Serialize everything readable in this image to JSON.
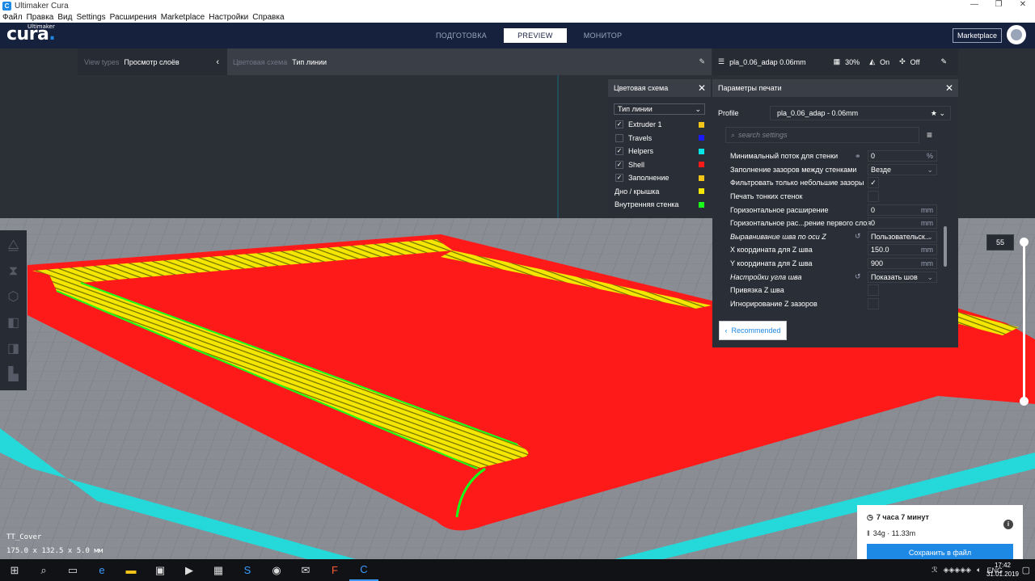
{
  "window": {
    "title": "Ultimaker Cura",
    "app_icon": "C",
    "controls": [
      "—",
      "❐",
      "✕"
    ]
  },
  "menu": [
    "Файл",
    "Правка",
    "Вид",
    "Settings",
    "Расширения",
    "Marketplace",
    "Настройки",
    "Справка"
  ],
  "header": {
    "logo": "cura",
    "logo_brand": "Ultimaker",
    "stages": [
      "ПОДГОТОВКА",
      "PREVIEW",
      "МОНИТОР"
    ],
    "active_stage": "PREVIEW",
    "marketplace_button": "Marketplace"
  },
  "view_bar": {
    "label": "View types",
    "value": "Просмотр слоёв"
  },
  "color_bar": {
    "label": "Цветовая схема",
    "value": "Тип линии"
  },
  "print_bar": {
    "profile": "pla_0.06_adap 0.06mm",
    "infill": "30%",
    "support": "On",
    "adhesion": "Off"
  },
  "legend": {
    "title": "Цветовая схема",
    "scheme": "Тип линии",
    "items": [
      {
        "label": "Extruder 1",
        "checkbox": true,
        "checked": true,
        "color": "#f5c518"
      },
      {
        "label": "Travels",
        "checkbox": true,
        "checked": false,
        "color": "#1a1aff"
      },
      {
        "label": "Helpers",
        "checkbox": true,
        "checked": true,
        "color": "#00e5e5"
      },
      {
        "label": "Shell",
        "checkbox": true,
        "checked": true,
        "color": "#ff1a1a"
      },
      {
        "label": "Заполнение",
        "checkbox": true,
        "checked": true,
        "color": "#f5c518"
      },
      {
        "label": "Дно / крышка",
        "checkbox": false,
        "checked": false,
        "color": "#f5e600"
      },
      {
        "label": "Внутренняя стенка",
        "checkbox": false,
        "checked": false,
        "color": "#1aff1a"
      }
    ]
  },
  "settings_panel": {
    "title": "Параметры печати",
    "profile_label": "Profile",
    "profile_value": "pla_0.06_adap - 0.06mm",
    "search_placeholder": "search settings",
    "rows": [
      {
        "label": "Минимальный поток для стенки",
        "value": "0",
        "unit": "%",
        "type": "text",
        "linked": true
      },
      {
        "label": "Заполнение зазоров между стенками",
        "value": "Везде",
        "type": "select"
      },
      {
        "label": "Фильтровать только небольшие зазоры",
        "checked": true,
        "type": "check"
      },
      {
        "label": "Печать тонких стенок",
        "checked": false,
        "type": "check"
      },
      {
        "label": "Горизонтальное расширение",
        "value": "0",
        "unit": "mm",
        "type": "text"
      },
      {
        "label": "Горизонтальное рас...рение первого слоя",
        "value": "0",
        "unit": "mm",
        "type": "text"
      },
      {
        "label": "Выравнивание шва по оси Z",
        "value": "Пользовательск...",
        "type": "select",
        "italic": true,
        "reset": true
      },
      {
        "label": "X координата для Z шва",
        "value": "150.0",
        "unit": "mm",
        "type": "text"
      },
      {
        "label": "Y координата для Z шва",
        "value": "900",
        "unit": "mm",
        "type": "text"
      },
      {
        "label": "Настройки угла шва",
        "value": "Показать шов",
        "type": "select",
        "italic": true,
        "reset": true
      },
      {
        "label": "Привязка Z шва",
        "checked": false,
        "type": "check"
      },
      {
        "label": "Игнорирование Z зазоров",
        "checked": false,
        "type": "check"
      }
    ],
    "recommended_button": "Recommended"
  },
  "layer_slider": {
    "current_layer": "55",
    "level": 1.0
  },
  "object_info": {
    "name": "TT_Cover",
    "dimensions": "175.0 x 132.5 x 5.0 мм"
  },
  "job": {
    "time": "7 часа 7 минут",
    "material": "34g · 11.33m",
    "save_button": "Сохранить в файл"
  },
  "taskbar": {
    "lang": "ENG",
    "time": "17:42",
    "date": "31.01.2019"
  },
  "colors": {
    "shell": "#ff1a1a",
    "infill": "#f5e600",
    "helpers": "#00e5e5",
    "accent": "#1e88e5",
    "header": "#16213d"
  }
}
